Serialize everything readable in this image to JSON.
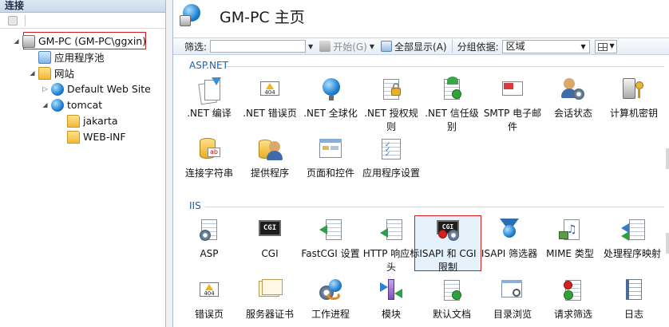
{
  "connections": {
    "header": "连接",
    "tree": [
      {
        "label": "GM-PC (GM-PC\\ggxin)",
        "icon": "server-icon"
      },
      {
        "label": "应用程序池",
        "icon": "app-pool-icon"
      },
      {
        "label": "网站",
        "icon": "sites-folder-icon"
      },
      {
        "label": "Default Web Site",
        "icon": "globe-icon"
      },
      {
        "label": "tomcat",
        "icon": "globe-icon"
      },
      {
        "label": "jakarta",
        "icon": "folder-icon"
      },
      {
        "label": "WEB-INF",
        "icon": "folder-icon"
      }
    ]
  },
  "main": {
    "title": "GM-PC 主页",
    "filter": {
      "label": "筛选:",
      "value": "",
      "start_label": "开始(G)",
      "show_all_label": "全部显示(A)",
      "group_label": "分组依据:",
      "group_value": "区域"
    },
    "sections": [
      {
        "name": "ASP.NET",
        "features": [
          {
            "label": ".NET 编译",
            "icon": "net-compile-icon"
          },
          {
            "label": ".NET 错误页",
            "icon": "net-error-pages-icon",
            "badge": "404"
          },
          {
            "label": ".NET 全球化",
            "icon": "net-globalization-icon"
          },
          {
            "label": ".NET 授权规则",
            "icon": "net-authorization-icon"
          },
          {
            "label": ".NET 信任级别",
            "icon": "net-trust-icon"
          },
          {
            "label": "SMTP 电子邮件",
            "icon": "smtp-email-icon"
          },
          {
            "label": "会话状态",
            "icon": "session-state-icon"
          },
          {
            "label": "计算机密钥",
            "icon": "machine-key-icon"
          },
          {
            "label": "连接字符串",
            "icon": "connection-strings-icon",
            "badge": "ab"
          },
          {
            "label": "提供程序",
            "icon": "providers-icon"
          },
          {
            "label": "页面和控件",
            "icon": "pages-controls-icon"
          },
          {
            "label": "应用程序设置",
            "icon": "app-settings-icon"
          }
        ]
      },
      {
        "name": "IIS",
        "features": [
          {
            "label": "ASP",
            "icon": "asp-icon"
          },
          {
            "label": "CGI",
            "icon": "cgi-icon",
            "badge": "CGI"
          },
          {
            "label": "FastCGI 设置",
            "icon": "fastcgi-icon"
          },
          {
            "label": "HTTP 响应标头",
            "icon": "http-headers-icon"
          },
          {
            "label": "ISAPI 和 CGI 限制",
            "icon": "isapi-cgi-restrictions-icon",
            "badge": "CGI"
          },
          {
            "label": "ISAPI 筛选器",
            "icon": "isapi-filters-icon"
          },
          {
            "label": "MIME 类型",
            "icon": "mime-types-icon"
          },
          {
            "label": "处理程序映射",
            "icon": "handler-mappings-icon"
          },
          {
            "label": "错误页",
            "icon": "error-pages-icon",
            "badge": "404"
          },
          {
            "label": "服务器证书",
            "icon": "server-certificates-icon"
          },
          {
            "label": "工作进程",
            "icon": "worker-processes-icon"
          },
          {
            "label": "模块",
            "icon": "modules-icon"
          },
          {
            "label": "默认文档",
            "icon": "default-document-icon"
          },
          {
            "label": "目录浏览",
            "icon": "directory-browsing-icon"
          },
          {
            "label": "请求筛选",
            "icon": "request-filtering-icon"
          },
          {
            "label": "日志",
            "icon": "logging-icon"
          }
        ]
      }
    ]
  }
}
